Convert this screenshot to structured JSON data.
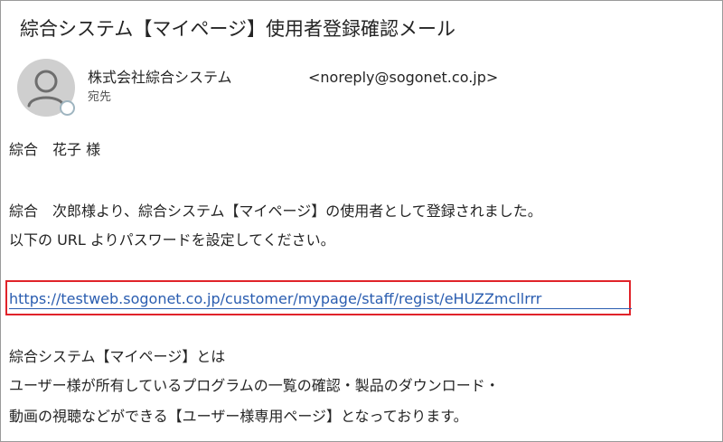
{
  "email": {
    "subject": "綜合システム【マイページ】使用者登録確認メール",
    "sender": {
      "name": "株式会社綜合システム",
      "email": "<noreply@sogonet.co.jp>",
      "to_label": "宛先",
      "avatar_icon": "person-icon",
      "presence_icon": "presence-status-icon"
    },
    "body": {
      "greeting": "綜合　花子 様",
      "line1": "綜合　次郎様より、綜合システム【マイページ】の使用者として登録されました。",
      "line2": "以下の URL よりパスワードを設定してください。",
      "link": "https://testweb.sogonet.co.jp/customer/mypage/staff/regist/eHUZZmcllrrr",
      "para2_line1": "綜合システム【マイページ】とは",
      "para2_line2": "ユーザー様が所有しているプログラムの一覧の確認・製品のダウンロード・",
      "para2_line3": "動画の視聴などができる【ユーザー様専用ページ】となっております。"
    }
  },
  "colors": {
    "link": "#2a5db0",
    "highlight_border": "#e0232a",
    "avatar_bg": "#cfcfcf",
    "avatar_fg": "#6e6e6e"
  }
}
